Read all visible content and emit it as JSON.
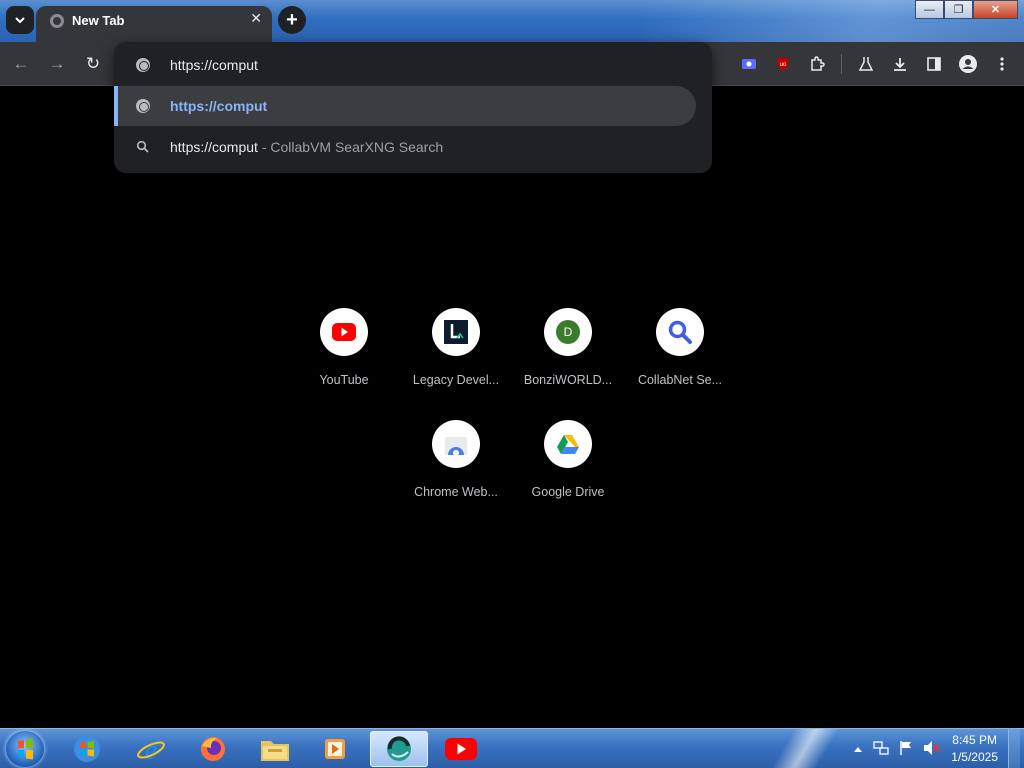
{
  "browser": {
    "tab": {
      "title": "New Tab",
      "close_glyph": "✕"
    },
    "new_tab_glyph": "+",
    "window_buttons": {
      "minimize": "—",
      "maximize": "❐",
      "close": "✕"
    }
  },
  "toolbar": {
    "back_glyph": "←",
    "forward_glyph": "→",
    "reload_glyph": "↻",
    "extensions": [
      "screencast-icon",
      "ublock-icon",
      "puzzle-icon",
      "labs-flask-icon",
      "download-icon",
      "side-panel-icon",
      "profile-icon",
      "menu-icon"
    ]
  },
  "omnibox": {
    "input_value": "https://comput",
    "suggestions": [
      {
        "text": "https://comput",
        "suffix": "",
        "icon": "globe-icon",
        "selected": true
      },
      {
        "text": "https://comput",
        "suffix": " - CollabVM SearXNG Search",
        "icon": "search-icon",
        "selected": false
      }
    ]
  },
  "shortcuts": [
    {
      "label": "YouTube",
      "icon": "youtube-icon"
    },
    {
      "label": "Legacy Devel...",
      "icon": "legacy-dev-icon"
    },
    {
      "label": "BonziWORLD...",
      "icon": "bonziworld-icon",
      "letter": "D"
    },
    {
      "label": "CollabNet Se...",
      "icon": "magnifier-icon"
    },
    {
      "label": "Chrome Web...",
      "icon": "chrome-web-store-icon"
    },
    {
      "label": "Google Drive",
      "icon": "google-drive-icon"
    }
  ],
  "taskbar": {
    "apps": [
      "windows-explorer-icon",
      "internet-explorer-icon",
      "firefox-icon",
      "file-explorer-icon",
      "media-player-icon",
      "collabvm-icon",
      "youtube-icon"
    ],
    "clock": {
      "time": "8:45 PM",
      "date": "1/5/2025"
    }
  },
  "colors": {
    "accent": "#8ab4f8",
    "omnibox_bg": "#202124",
    "toolbar_bg": "#35363a",
    "youtube_red": "#ff0000"
  }
}
